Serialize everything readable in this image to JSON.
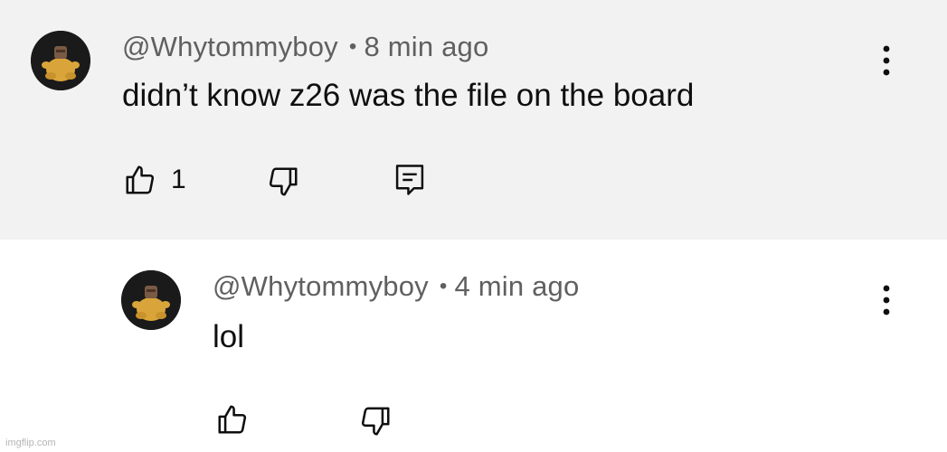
{
  "comments": [
    {
      "handle": "@Whytommyboy",
      "separator": "•",
      "time": "8 min ago",
      "text": "didn’t know z26 was the file on the board",
      "likes": "1"
    },
    {
      "handle": "@Whytommyboy",
      "separator": "•",
      "time": "4 min ago",
      "text": "lol"
    }
  ],
  "watermark": "imgflip.com",
  "colors": {
    "parent_background": "#f2f2f2",
    "reply_background": "#ffffff",
    "meta_text": "#606060",
    "body_text": "#0f0f0f"
  },
  "icons": {
    "like": "thumbs-up-icon",
    "dislike": "thumbs-down-icon",
    "reply": "reply-comment-icon",
    "more": "vertical-dots-icon"
  }
}
